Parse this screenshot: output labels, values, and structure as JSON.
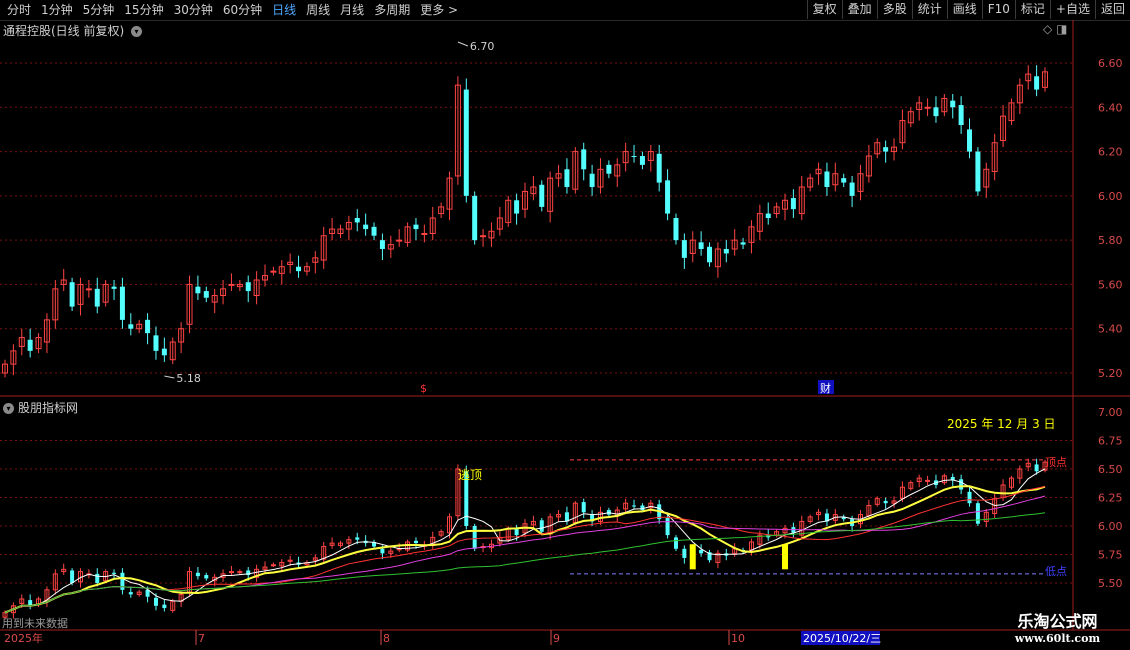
{
  "toolbar": {
    "periods": [
      "分时",
      "1分钟",
      "5分钟",
      "15分钟",
      "30分钟",
      "60分钟",
      "日线",
      "周线",
      "月线",
      "多周期",
      "更多 >"
    ],
    "active_period": "日线",
    "buttons": [
      "复权",
      "叠加",
      "多股",
      "统计",
      "画线",
      "F10",
      "标记",
      "+自选",
      "返回"
    ]
  },
  "main_panel": {
    "title": "通程控股(日线 前复权)",
    "high_label": "6.70",
    "low_label": "5.18",
    "y_ticks": [
      "6.60",
      "6.40",
      "6.20",
      "6.00",
      "5.80",
      "5.60",
      "5.40",
      "5.20"
    ],
    "markers": [
      "$",
      "财"
    ]
  },
  "indicator_panel": {
    "title": "股朋指标网",
    "date_text": "2025 年 12 月 3 日",
    "escape_top_label": "逃顶",
    "top_label": "顶点",
    "bottom_label": "低点",
    "y_ticks": [
      "7.00",
      "6.75",
      "6.50",
      "6.25",
      "6.00",
      "5.75",
      "5.50"
    ],
    "footer_note": "用到未来数据"
  },
  "time_axis": {
    "labels": [
      "2025年",
      "7",
      "8",
      "9",
      "10"
    ],
    "cursor_date": "2025/10/22/三"
  },
  "watermark": {
    "line1": "乐淘公式网",
    "line2": "www.60lt.com"
  },
  "colors": {
    "up": "#ff4444",
    "down": "#54ffff",
    "grid": "#7a1010",
    "axis": "#d84a4a",
    "accent": "#4fa8ff",
    "ma": "#ffff40"
  },
  "chart_data": {
    "type": "candlestick",
    "ylim": [
      5.1,
      6.75
    ],
    "x_month_labels": [
      "7",
      "8",
      "9",
      "10"
    ],
    "closes": [
      5.24,
      5.3,
      5.36,
      5.3,
      5.36,
      5.44,
      5.58,
      5.62,
      5.5,
      5.6,
      5.58,
      5.5,
      5.6,
      5.58,
      5.44,
      5.4,
      5.42,
      5.38,
      5.3,
      5.28,
      5.34,
      5.4,
      5.6,
      5.56,
      5.54,
      5.55,
      5.58,
      5.6,
      5.6,
      5.57,
      5.62,
      5.64,
      5.66,
      5.68,
      5.7,
      5.66,
      5.68,
      5.72,
      5.82,
      5.85,
      5.85,
      5.88,
      5.88,
      5.85,
      5.82,
      5.76,
      5.78,
      5.8,
      5.86,
      5.85,
      5.83,
      5.9,
      5.95,
      6.08,
      6.5,
      6.0,
      5.8,
      5.82,
      5.84,
      5.9,
      5.98,
      5.92,
      6.02,
      6.04,
      5.95,
      6.08,
      6.1,
      6.04,
      6.2,
      6.12,
      6.04,
      6.12,
      6.1,
      6.14,
      6.2,
      6.18,
      6.14,
      6.2,
      6.06,
      5.92,
      5.8,
      5.72,
      5.8,
      5.76,
      5.7,
      5.76,
      5.74,
      5.8,
      5.78,
      5.86,
      5.92,
      5.9,
      5.95,
      5.98,
      5.94,
      6.04,
      6.08,
      6.12,
      6.04,
      6.1,
      6.06,
      6.0,
      6.1,
      6.18,
      6.24,
      6.2,
      6.22,
      6.34,
      6.38,
      6.42,
      6.4,
      6.36,
      6.44,
      6.4,
      6.32,
      6.2,
      6.02,
      6.12,
      6.24,
      6.36,
      6.42,
      6.5,
      6.55,
      6.48,
      6.56
    ]
  }
}
